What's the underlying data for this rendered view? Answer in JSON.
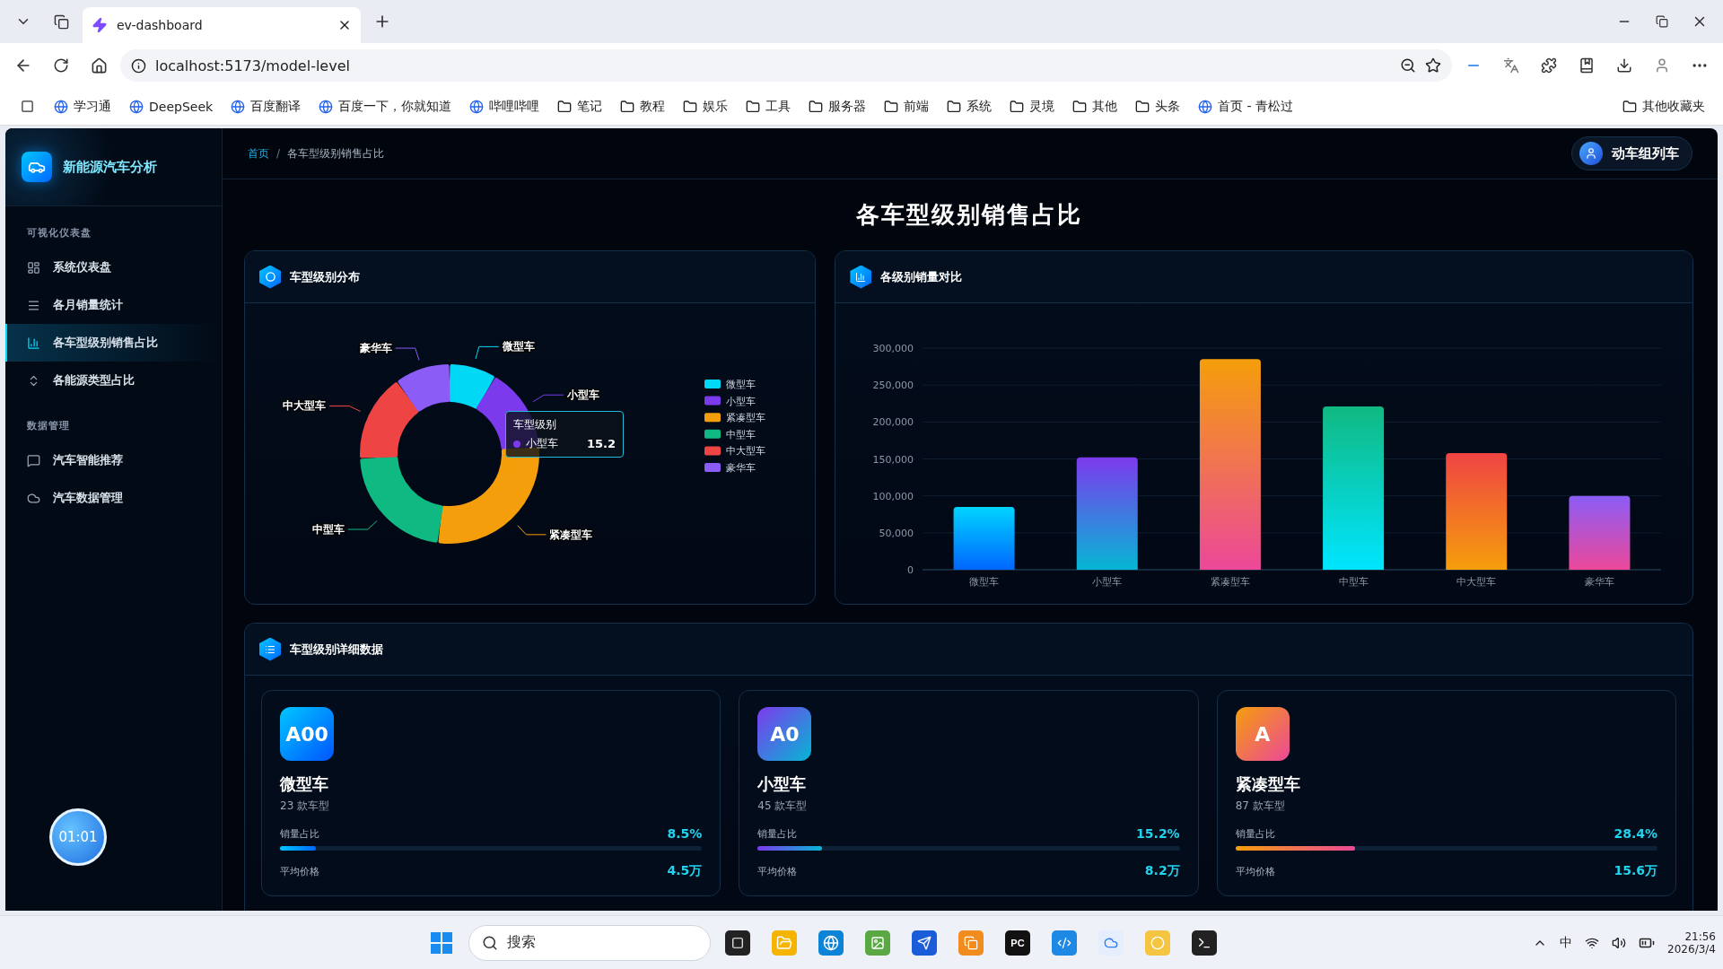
{
  "browser": {
    "tab_title": "ev-dashboard",
    "url": "localhost:5173/model-level",
    "bookmarks": [
      {
        "label": "学习通",
        "kind": "site"
      },
      {
        "label": "DeepSeek",
        "kind": "site"
      },
      {
        "label": "百度翻译",
        "kind": "site"
      },
      {
        "label": "百度一下，你就知道",
        "kind": "site"
      },
      {
        "label": "哔哩哔哩",
        "kind": "site"
      },
      {
        "label": "笔记",
        "kind": "folder"
      },
      {
        "label": "教程",
        "kind": "folder"
      },
      {
        "label": "娱乐",
        "kind": "folder"
      },
      {
        "label": "工具",
        "kind": "folder"
      },
      {
        "label": "服务器",
        "kind": "folder"
      },
      {
        "label": "前端",
        "kind": "folder"
      },
      {
        "label": "系统",
        "kind": "folder"
      },
      {
        "label": "灵境",
        "kind": "folder"
      },
      {
        "label": "其他",
        "kind": "folder"
      },
      {
        "label": "头条",
        "kind": "folder"
      },
      {
        "label": "首页 - 青松过",
        "kind": "site"
      }
    ],
    "other_bookmarks": "其他收藏夹"
  },
  "app": {
    "brand": "新能源汽车分析",
    "sidebar": [
      {
        "title": "可视化仪表盘",
        "items": [
          {
            "label": "系统仪表盘",
            "selected": false
          },
          {
            "label": "各月销量统计",
            "selected": false
          },
          {
            "label": "各车型级别销售占比",
            "selected": true
          },
          {
            "label": "各能源类型占比",
            "selected": false
          }
        ]
      },
      {
        "title": "数据管理",
        "items": [
          {
            "label": "汽车智能推荐",
            "selected": false
          },
          {
            "label": "汽车数据管理",
            "selected": false
          }
        ]
      }
    ],
    "timer": "01:01",
    "breadcrumb": [
      "首页",
      "各车型级别销售占比"
    ],
    "breadcrumb_separator": "/",
    "user_button": "动车组列车",
    "page_title": "各车型级别销售占比",
    "donut_panel": {
      "title": "车型级别分布",
      "chart_data": {
        "type": "donut",
        "categories": [
          "微型车",
          "小型车",
          "紧凑型车",
          "中型车",
          "中大型车",
          "豪华车"
        ],
        "series": [
          {
            "name": "车型级别",
            "values": [
              8.5,
              15.2,
              28.4,
              22.1,
              15.8,
              10.0
            ]
          }
        ],
        "colors": [
          "#00d8f5",
          "#7c3aed",
          "#f59e0b",
          "#10b981",
          "#ef4444",
          "#8b5cf6"
        ],
        "legend": true
      },
      "tooltip": {
        "label": "小型车",
        "value": "15.2",
        "color": "#7c3aed"
      }
    },
    "bar_panel": {
      "title": "各级别销量对比",
      "chart_data": {
        "type": "bar",
        "categories": [
          "微型车",
          "小型车",
          "紧凑型车",
          "中型车",
          "中大型车",
          "豪华车"
        ],
        "series": [
          {
            "values": [
              85000,
              152000,
              285000,
              221000,
              158000,
              100000
            ]
          }
        ],
        "grid": true,
        "ylim": [
          0,
          300000
        ],
        "yticks": [
          {
            "value": 0,
            "label": "0"
          },
          {
            "value": 50000,
            "label": "50,000"
          },
          {
            "value": 100000,
            "label": "100,000"
          },
          {
            "value": 150000,
            "label": "150,000"
          },
          {
            "value": 200000,
            "label": "200,000"
          },
          {
            "value": 250000,
            "label": "250,000"
          },
          {
            "value": 300000,
            "label": "300,000"
          }
        ]
      }
    },
    "detail_panel": {
      "title": "车型级别详细数据",
      "cards": [
        {
          "code": "A00",
          "name": "微型车",
          "models": "23 款车型",
          "share_label": "销量占比",
          "share": "8.5%",
          "level": 0.085,
          "price_label": "平均价格",
          "price": "4.5万"
        },
        {
          "code": "A0",
          "name": "小型车",
          "models": "45 款车型",
          "share_label": "销量占比",
          "share": "15.2%",
          "level": 0.152,
          "price_label": "平均价格",
          "price": "8.2万"
        },
        {
          "code": "A",
          "name": "紧凑型车",
          "models": "87 款车型",
          "share_label": "销量占比",
          "share": "28.4%",
          "level": 0.284,
          "price_label": "平均价格",
          "price": "15.6万"
        }
      ]
    }
  },
  "taskbar": {
    "search_placeholder": "搜索",
    "app_badge": "PC",
    "ime": "中",
    "time": "21:56",
    "date": "2026/3/4"
  }
}
